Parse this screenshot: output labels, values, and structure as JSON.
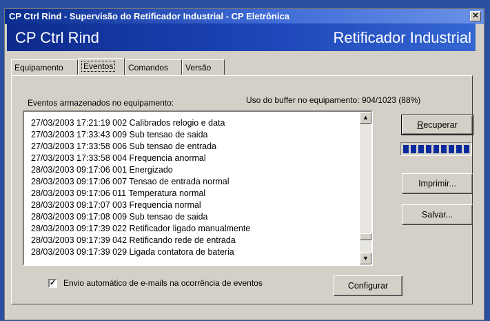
{
  "window": {
    "title": "CP Ctrl Rind - Supervisão do Retificador Industrial - CP Eletrônica",
    "close_icon": "close-icon"
  },
  "banner": {
    "left": "CP Ctrl Rind",
    "right": "Retificador Industrial"
  },
  "tabs": [
    {
      "label": "Equipamento",
      "active": false
    },
    {
      "label": "Eventos",
      "active": true
    },
    {
      "label": "Comandos",
      "active": false
    },
    {
      "label": "Versão",
      "active": false
    }
  ],
  "events_panel": {
    "stored_label": "Eventos armazenados no equipamento:",
    "buffer_label": "Uso do buffer no equipamento: 904/1023 (88%)",
    "events": [
      "27/03/2003  17:21:19  002  Calibrados relogio e data",
      "27/03/2003  17:33:43  009  Sub tensao de saida",
      "27/03/2003  17:33:58  006  Sub tensao de entrada",
      "27/03/2003  17:33:58  004  Frequencia anormal",
      "28/03/2003  09:17:06  001  Energizado",
      "28/03/2003  09:17:06  007  Tensao de entrada normal",
      "28/03/2003  09:17:06  011  Temperatura normal",
      "28/03/2003  09:17:07  003  Frequencia normal",
      "28/03/2003  09:17:08  009  Sub tensao de saida",
      "28/03/2003  09:17:39  022  Retificador ligado manualmente",
      "28/03/2003  09:17:39  042  Retificando rede de entrada",
      "28/03/2003  09:17:39  029  Ligada contatora de bateria"
    ],
    "recover_button": {
      "first": "R",
      "rest": "ecuperar"
    },
    "progress_fraction": 1.0,
    "print_button": "Imprimir...",
    "save_button": "Salvar...",
    "email_checkbox": {
      "checked": true,
      "label": "Envio automático de e-mails na ocorrência de eventos"
    },
    "configure_button": "Configurar"
  }
}
